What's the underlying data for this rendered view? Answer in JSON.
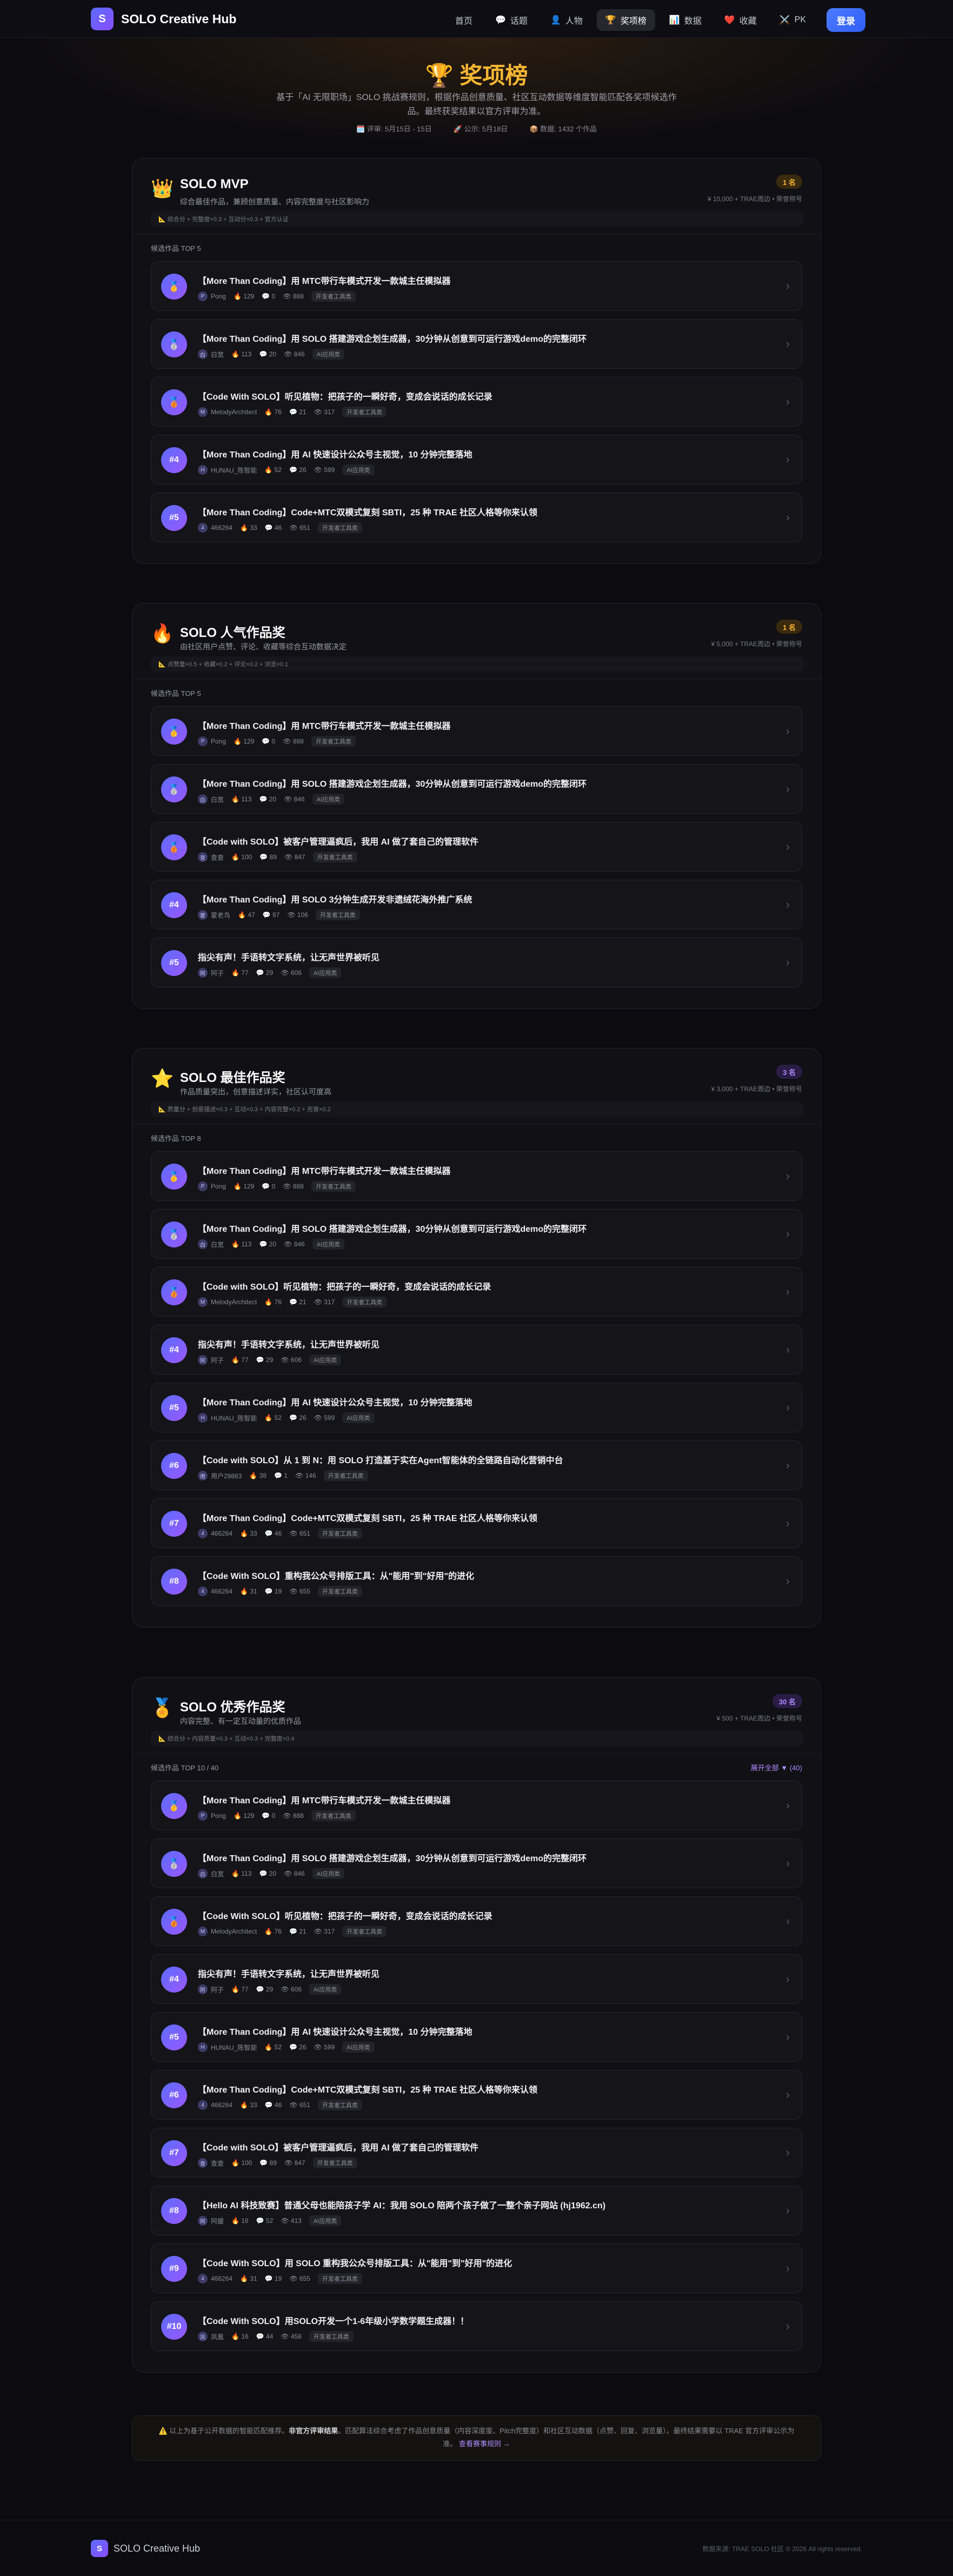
{
  "nav": {
    "brand_logo": "S",
    "brand_name": "SOLO Creative Hub",
    "items": [
      {
        "icon": "",
        "label": "首页"
      },
      {
        "icon": "💬",
        "label": "话题"
      },
      {
        "icon": "👤",
        "label": "人物"
      },
      {
        "icon": "🏆",
        "label": "奖项榜"
      },
      {
        "icon": "📊",
        "label": "数据"
      },
      {
        "icon": "❤️",
        "label": "收藏"
      },
      {
        "icon": "⚔️",
        "label": "PK"
      }
    ],
    "login": "登录"
  },
  "hero": {
    "title": "🏆 奖项榜",
    "subtitle": "基于「AI 无限职场」SOLO 挑战赛规则，根据作品创意质量、社区互动数据等维度智能匹配各奖项候选作品。最终获奖结果以官方评审为准。",
    "meta": [
      "🗓️ 评审: 5月15日 - 15日",
      "🚀 公示: 5月18日",
      "📦 数据: 1432 个作品"
    ]
  },
  "awards": [
    {
      "icon": "👑",
      "title": "SOLO MVP",
      "desc": "综合最佳作品，兼顾创意质量、内容完整度与社区影响力",
      "count": "1 名",
      "prize": "¥ 10,000 + TRAE周边 • 荣誉称号",
      "criteria": "📐 综合分 + 完整度×0.3 + 互动分×0.3 + 官方认证",
      "list_label": "候选作品 TOP 5",
      "expand": "",
      "entries": [
        {
          "rank": "🥇",
          "title": "【More Than Coding】用 MTC带行车模式开发一款城主任模拟器",
          "author": "Pong",
          "av": "P",
          "likes": "129",
          "comments": "0",
          "views": "888",
          "tag": "开发者工具类"
        },
        {
          "rank": "🥈",
          "title": "【More Than Coding】用 SOLO 搭建游戏企划生成器，30分钟从创意到可运行游戏demo的完整闭环",
          "author": "白宽",
          "av": "白",
          "likes": "113",
          "comments": "20",
          "views": "846",
          "tag": "AI应用类"
        },
        {
          "rank": "🥉",
          "title": "【Code With SOLO】听见植物：把孩子的一瞬好奇，变成会说话的成长记录",
          "author": "MelodyArchitect",
          "av": "M",
          "likes": "76",
          "comments": "21",
          "views": "317",
          "tag": "开发者工具类"
        },
        {
          "rank": "#4",
          "title": "【More Than Coding】用 AI 快速设计公众号主视觉，10 分钟完整落地",
          "author": "HUNAU_陈智能",
          "av": "H",
          "likes": "52",
          "comments": "26",
          "views": "599",
          "tag": "AI应用类"
        },
        {
          "rank": "#5",
          "title": "【More Than Coding】Code+MTC双模式复刻 SBTI，25 种 TRAE 社区人格等你来认领",
          "author": "466264",
          "av": "4",
          "likes": "33",
          "comments": "46",
          "views": "651",
          "tag": "开发者工具类"
        }
      ]
    },
    {
      "icon": "🔥",
      "title": "SOLO 人气作品奖",
      "desc": "由社区用户点赞、评论、收藏等综合互动数据决定",
      "count": "1 名",
      "prize": "¥ 5,000 + TRAE周边 • 荣誉称号",
      "criteria": "📐 点赞量×0.5 + 收藏×0.2 + 评论×0.2 + 浏览×0.1",
      "list_label": "候选作品 TOP 5",
      "expand": "",
      "entries": [
        {
          "rank": "🥇",
          "title": "【More Than Coding】用 MTC带行车模式开发一款城主任模拟器",
          "author": "Pong",
          "av": "P",
          "likes": "129",
          "comments": "0",
          "views": "888",
          "tag": "开发者工具类"
        },
        {
          "rank": "🥈",
          "title": "【More Than Coding】用 SOLO 搭建游戏企划生成器，30分钟从创意到可运行游戏demo的完整闭环",
          "author": "白宽",
          "av": "白",
          "likes": "113",
          "comments": "20",
          "views": "846",
          "tag": "AI应用类"
        },
        {
          "rank": "🥉",
          "title": "【Code with SOLO】被客户管理逼疯后，我用 AI 做了套自己的管理软件",
          "author": "查查",
          "av": "查",
          "likes": "100",
          "comments": "89",
          "views": "847",
          "tag": "开发者工具类"
        },
        {
          "rank": "#4",
          "title": "【More Than Coding】用 SOLO 3分钟生成开发非遗绒花海外推广系统",
          "author": "蒙老鸟",
          "av": "蒙",
          "likes": "47",
          "comments": "97",
          "views": "106",
          "tag": "开发者工具类"
        },
        {
          "rank": "#5",
          "title": "指尖有声！手语转文字系统，让无声世界被听见",
          "author": "阿子",
          "av": "阿",
          "likes": "77",
          "comments": "29",
          "views": "606",
          "tag": "AI应用类"
        }
      ]
    },
    {
      "icon": "⭐",
      "title": "SOLO 最佳作品奖",
      "desc": "作品质量突出，创意描述详实，社区认可度高",
      "count": "3 名",
      "prize": "¥ 3,000 + TRAE周边 • 荣誉称号",
      "criteria": "📐 质量分 + 创意描述×0.3 + 互动×0.3 + 内容完整×0.2 + 完善×0.2",
      "list_label": "候选作品 TOP 8",
      "expand": "",
      "entries": [
        {
          "rank": "🥇",
          "title": "【More Than Coding】用 MTC带行车模式开发一款城主任模拟器",
          "author": "Pong",
          "av": "P",
          "likes": "129",
          "comments": "0",
          "views": "888",
          "tag": "开发者工具类"
        },
        {
          "rank": "🥈",
          "title": "【More Than Coding】用 SOLO 搭建游戏企划生成器，30分钟从创意到可运行游戏demo的完整闭环",
          "author": "白宽",
          "av": "白",
          "likes": "113",
          "comments": "20",
          "views": "846",
          "tag": "AI应用类"
        },
        {
          "rank": "🥉",
          "title": "【Code with SOLO】听见植物：把孩子的一瞬好奇，变成会说话的成长记录",
          "author": "MelodyArchitect",
          "av": "M",
          "likes": "76",
          "comments": "21",
          "views": "317",
          "tag": "开发者工具类"
        },
        {
          "rank": "#4",
          "title": "指尖有声！手语转文字系统，让无声世界被听见",
          "author": "阿子",
          "av": "阿",
          "likes": "77",
          "comments": "29",
          "views": "606",
          "tag": "AI应用类"
        },
        {
          "rank": "#5",
          "title": "【More Than Coding】用 AI 快速设计公众号主视觉，10 分钟完整落地",
          "author": "HUNAU_陈智能",
          "av": "H",
          "likes": "52",
          "comments": "26",
          "views": "599",
          "tag": "AI应用类"
        },
        {
          "rank": "#6",
          "title": "【Code with SOLO】从 1 到 N：用 SOLO 打造基于实在Agent智能体的全链路自动化营销中台",
          "author": "用户29863",
          "av": "用",
          "likes": "38",
          "comments": "1",
          "views": "146",
          "tag": "开发者工具类"
        },
        {
          "rank": "#7",
          "title": "【More Than Coding】Code+MTC双模式复刻 SBTI，25 种 TRAE 社区人格等你来认领",
          "author": "466264",
          "av": "4",
          "likes": "33",
          "comments": "46",
          "views": "651",
          "tag": "开发者工具类"
        },
        {
          "rank": "#8",
          "title": "【Code With SOLO】重构我公众号排版工具：从\"能用\"到\"好用\"的进化",
          "author": "466264",
          "av": "4",
          "likes": "31",
          "comments": "19",
          "views": "655",
          "tag": "开发者工具类"
        }
      ]
    },
    {
      "icon": "🏅",
      "title": "SOLO 优秀作品奖",
      "desc": "内容完整、有一定互动量的优质作品",
      "count": "30 名",
      "prize": "¥ 500 + TRAE周边 • 荣誉称号",
      "criteria": "📐 综合分 + 内容质量×0.3 + 互动×0.3 + 完整度×0.4",
      "list_label": "候选作品 TOP 10 / 40",
      "expand": "展开全部 ▼ (40)",
      "entries": [
        {
          "rank": "🥇",
          "title": "【More Than Coding】用 MTC带行车模式开发一款城主任模拟器",
          "author": "Pong",
          "av": "P",
          "likes": "129",
          "comments": "0",
          "views": "888",
          "tag": "开发者工具类"
        },
        {
          "rank": "🥈",
          "title": "【More Than Coding】用 SOLO 搭建游戏企划生成器，30分钟从创意到可运行游戏demo的完整闭环",
          "author": "白宽",
          "av": "白",
          "likes": "113",
          "comments": "20",
          "views": "846",
          "tag": "AI应用类"
        },
        {
          "rank": "🥉",
          "title": "【Code With SOLO】听见植物：把孩子的一瞬好奇，变成会说话的成长记录",
          "author": "MelodyArchitect",
          "av": "M",
          "likes": "76",
          "comments": "21",
          "views": "317",
          "tag": "开发者工具类"
        },
        {
          "rank": "#4",
          "title": "指尖有声！手语转文字系统，让无声世界被听见",
          "author": "阿子",
          "av": "阿",
          "likes": "77",
          "comments": "29",
          "views": "606",
          "tag": "AI应用类"
        },
        {
          "rank": "#5",
          "title": "【More Than Coding】用 AI 快速设计公众号主视觉，10 分钟完整落地",
          "author": "HUNAU_陈智能",
          "av": "H",
          "likes": "52",
          "comments": "26",
          "views": "599",
          "tag": "AI应用类"
        },
        {
          "rank": "#6",
          "title": "【More Than Coding】Code+MTC双模式复刻 SBTI，25 种 TRAE 社区人格等你来认领",
          "author": "466264",
          "av": "4",
          "likes": "33",
          "comments": "46",
          "views": "651",
          "tag": "开发者工具类"
        },
        {
          "rank": "#7",
          "title": "【Code with SOLO】被客户管理逼疯后，我用 AI 做了套自己的管理软件",
          "author": "查查",
          "av": "查",
          "likes": "100",
          "comments": "89",
          "views": "847",
          "tag": "开发者工具类"
        },
        {
          "rank": "#8",
          "title": "【Hello AI 科技致赛】普通父母也能陪孩子学 AI：我用 SOLO 陪两个孩子做了一整个亲子网站 (hj1962.cn)",
          "author": "阿媛",
          "av": "阿",
          "likes": "16",
          "comments": "52",
          "views": "413",
          "tag": "AI应用类"
        },
        {
          "rank": "#9",
          "title": "【Code With SOLO】用 SOLO 重构我公众号排版工具：从\"能用\"到\"好用\"的进化",
          "author": "466264",
          "av": "4",
          "likes": "31",
          "comments": "19",
          "views": "655",
          "tag": "开发者工具类"
        },
        {
          "rank": "#10",
          "title": "【Code With SOLO】用SOLO开发一个1-6年级小学数学题生成器！！",
          "author": "凤凰",
          "av": "凤",
          "likes": "16",
          "comments": "44",
          "views": "458",
          "tag": "开发者工具类"
        }
      ]
    }
  ],
  "note": {
    "prefix": "⚠️ 以上为基于公开数据的智能匹配推荐。",
    "bold": "非官方评审结果",
    "body": "。匹配算法综合考虑了作品创意质量（内容深度度、Pitch完整度）和社区互动数据（点赞、回复、浏览量）。最终结果需要以 TRAE 官方评审公示为准。",
    "link": "查看赛事规则 →"
  },
  "footer": {
    "logo": "S",
    "name": "SOLO Creative Hub",
    "copy": "数据来源: TRAE SOLO 社区 © 2026 All rights reserved."
  },
  "colors": {
    "accent_gold": "#f7b733",
    "accent_purple": "#8a4dff",
    "primary_blue": "#3a6bff"
  }
}
